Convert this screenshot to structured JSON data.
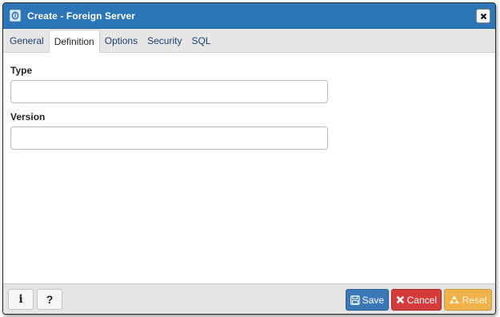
{
  "window": {
    "title": "Create - Foreign Server",
    "icon": "foreign-server-icon",
    "close_icon": "close-icon"
  },
  "tabs": [
    {
      "label": "General",
      "active": false
    },
    {
      "label": "Definition",
      "active": true
    },
    {
      "label": "Options",
      "active": false
    },
    {
      "label": "Security",
      "active": false
    },
    {
      "label": "SQL",
      "active": false
    }
  ],
  "form": {
    "type_label": "Type",
    "type_value": "",
    "version_label": "Version",
    "version_value": ""
  },
  "footer": {
    "info_glyph": "i",
    "help_glyph": "?",
    "save_label": "Save",
    "cancel_label": "Cancel",
    "reset_label": "Reset"
  },
  "colors": {
    "titlebar": "#2c76b8",
    "save": "#3b78b5",
    "cancel": "#d43c3c",
    "reset": "#f0b24a"
  }
}
